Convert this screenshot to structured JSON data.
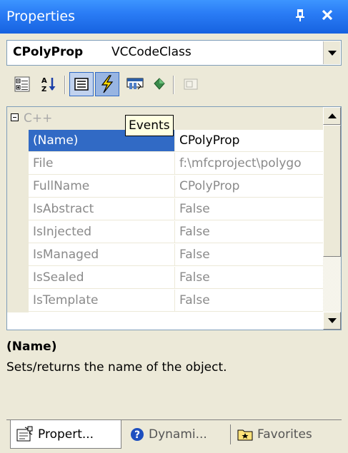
{
  "window": {
    "title": "Properties",
    "pin_glyph": "ꟹ",
    "close_glyph": "✕"
  },
  "object_selector": {
    "name": "CPolyProp",
    "type": "VCCodeClass"
  },
  "toolbar": {
    "buttons": [
      {
        "icon": "categorized-icon",
        "state": "normal"
      },
      {
        "icon": "alphabetical-icon",
        "state": "normal"
      },
      {
        "icon": "properties-icon",
        "state": "pressed"
      },
      {
        "icon": "events-icon",
        "state": "hot"
      },
      {
        "icon": "messages-icon",
        "state": "normal"
      },
      {
        "icon": "overrides-icon",
        "state": "normal"
      },
      {
        "icon": "property-pages-icon",
        "state": "disabled"
      }
    ]
  },
  "tooltip": "Events",
  "grid": {
    "category": "C++",
    "rows": [
      {
        "name": "(Name)",
        "value": "CPolyProp",
        "selected": true
      },
      {
        "name": "File",
        "value": "f:\\mfcproject\\polygo"
      },
      {
        "name": "FullName",
        "value": "CPolyProp"
      },
      {
        "name": "IsAbstract",
        "value": "False"
      },
      {
        "name": "IsInjected",
        "value": "False"
      },
      {
        "name": "IsManaged",
        "value": "False"
      },
      {
        "name": "IsSealed",
        "value": "False"
      },
      {
        "name": "IsTemplate",
        "value": "False"
      }
    ]
  },
  "description": {
    "title": "(Name)",
    "text": "Sets/returns the name of the object."
  },
  "tabs": [
    {
      "label": "Propert...",
      "icon": "property-sheet-icon",
      "active": true
    },
    {
      "label": "Dynami...",
      "icon": "help-icon",
      "active": false
    },
    {
      "label": "Favorites",
      "icon": "favorites-icon",
      "active": false
    }
  ],
  "colors": {
    "titlebar": "#2a7cf5",
    "selection": "#316ac5",
    "chrome": "#ece9d8",
    "tooltip_bg": "#ffffe1"
  }
}
